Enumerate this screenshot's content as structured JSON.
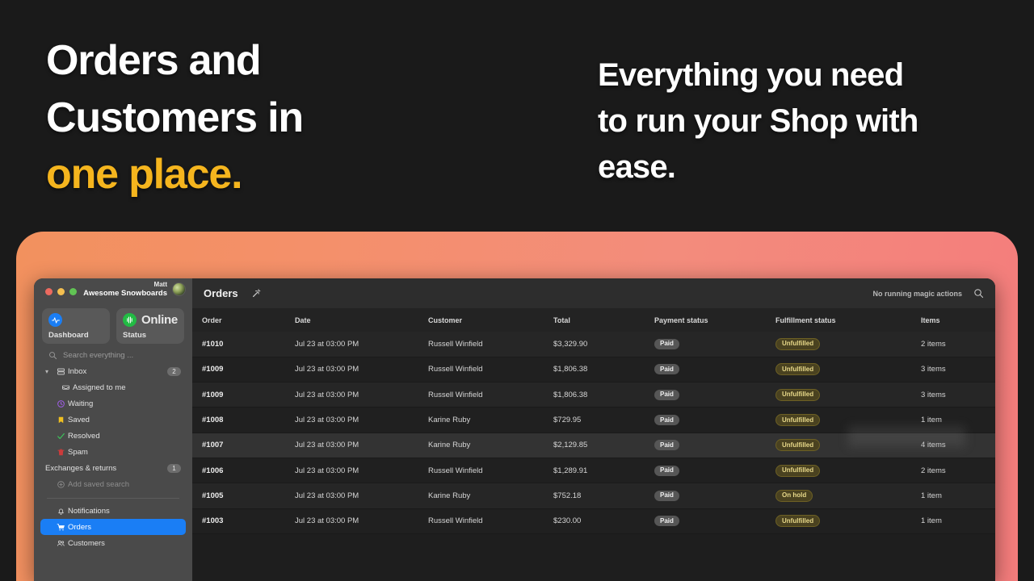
{
  "hero": {
    "left_line1": "Orders and",
    "left_line2": "Customers in",
    "left_line3": "one place.",
    "right_line1": "Everything you need",
    "right_line2": "to run your Shop with",
    "right_line3": "ease."
  },
  "colors": {
    "accent_yellow": "#f5b51e",
    "panel_gradient_start": "#f2915e",
    "panel_gradient_end": "#f47c7c",
    "active_blue": "#1a7ef5",
    "background": "#1a1a1a"
  },
  "window": {
    "account_name": "Matt",
    "shop_name": "Awesome Snowboards",
    "traffic_lights": [
      "close-red",
      "minimize-yellow",
      "maximize-green"
    ]
  },
  "sidebar": {
    "cards": [
      {
        "label": "Dashboard",
        "icon": "activity-icon"
      },
      {
        "label": "Status",
        "value": "Online",
        "icon": "broadcast-icon"
      }
    ],
    "search_placeholder": "Search everything ...",
    "items": [
      {
        "label": "Inbox",
        "icon": "inbox-icon",
        "badge": "2",
        "expanded": true
      },
      {
        "label": "Assigned to me",
        "icon": "tray-icon",
        "indent": true
      },
      {
        "label": "Waiting",
        "icon": "clock-icon"
      },
      {
        "label": "Saved",
        "icon": "bookmark-icon"
      },
      {
        "label": "Resolved",
        "icon": "check-icon"
      },
      {
        "label": "Spam",
        "icon": "trash-icon"
      },
      {
        "label": "Exchanges & returns",
        "badge": "1"
      },
      {
        "label": "Add saved search",
        "icon": "plus-circle-icon",
        "muted": true
      }
    ],
    "bottom_items": [
      {
        "label": "Notifications",
        "icon": "bell-icon",
        "active": false
      },
      {
        "label": "Orders",
        "icon": "cart-icon",
        "active": true
      },
      {
        "label": "Customers",
        "icon": "people-icon",
        "active": false
      }
    ]
  },
  "main": {
    "title": "Orders",
    "wand_icon": "magic-wand-icon",
    "magic_status": "No running magic actions",
    "search_icon": "search-icon",
    "table": {
      "columns": [
        "Order",
        "Date",
        "Customer",
        "Total",
        "Payment status",
        "Fulfillment status",
        "Items"
      ],
      "rows": [
        {
          "order": "#1010",
          "date": "Jul 23 at 03:00 PM",
          "customer": "Russell Winfield",
          "total": "$3,329.90",
          "payment": "Paid",
          "fulfillment": "Unfulfilled",
          "items": "2 items"
        },
        {
          "order": "#1009",
          "date": "Jul 23 at 03:00 PM",
          "customer": "Russell Winfield",
          "total": "$1,806.38",
          "payment": "Paid",
          "fulfillment": "Unfulfilled",
          "items": "3 items"
        },
        {
          "order": "#1009",
          "date": "Jul 23 at 03:00 PM",
          "customer": "Russell Winfield",
          "total": "$1,806.38",
          "payment": "Paid",
          "fulfillment": "Unfulfilled",
          "items": "3 items"
        },
        {
          "order": "#1008",
          "date": "Jul 23 at 03:00 PM",
          "customer": "Karine Ruby",
          "total": "$729.95",
          "payment": "Paid",
          "fulfillment": "Unfulfilled",
          "items": "1 item"
        },
        {
          "order": "#1007",
          "date": "Jul 23 at 03:00 PM",
          "customer": "Karine Ruby",
          "total": "$2,129.85",
          "payment": "Paid",
          "fulfillment": "Unfulfilled",
          "items": "4 items",
          "hover": true
        },
        {
          "order": "#1006",
          "date": "Jul 23 at 03:00 PM",
          "customer": "Russell Winfield",
          "total": "$1,289.91",
          "payment": "Paid",
          "fulfillment": "Unfulfilled",
          "items": "2 items"
        },
        {
          "order": "#1005",
          "date": "Jul 23 at 03:00 PM",
          "customer": "Karine Ruby",
          "total": "$752.18",
          "payment": "Paid",
          "fulfillment": "On hold",
          "items": "1 item"
        },
        {
          "order": "#1003",
          "date": "Jul 23 at 03:00 PM",
          "customer": "Russell Winfield",
          "total": "$230.00",
          "payment": "Paid",
          "fulfillment": "Unfulfilled",
          "items": "1 item"
        }
      ]
    }
  }
}
